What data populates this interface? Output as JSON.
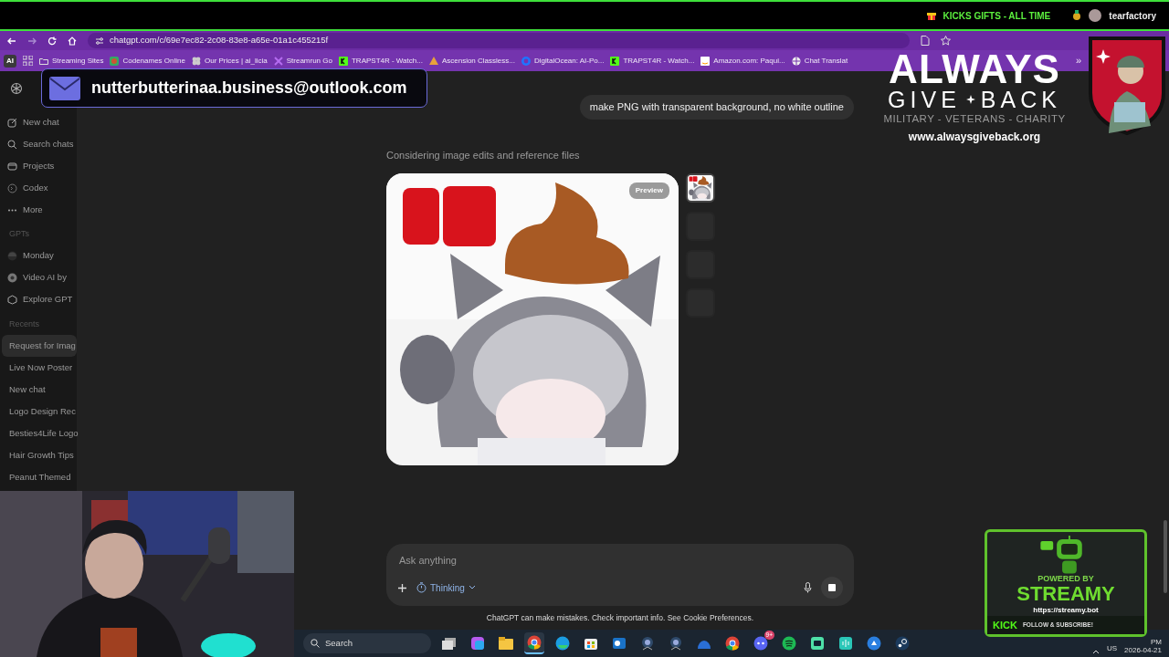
{
  "stream_bar": {
    "gifts_label": "KICKS GIFTS - ALL TIME",
    "username": "tearfactory"
  },
  "browser": {
    "url": "chatgpt.com/c/69e7ec82-2c08-83e8-a65e-01a1c455215f",
    "ai_badge": "AI",
    "overflow": "»",
    "bookmarks": [
      {
        "label": "Streaming Sites",
        "kind": "folder"
      },
      {
        "label": "Codenames Online",
        "kind": "game"
      },
      {
        "label": "Our Prices | ai_licia",
        "kind": "grid"
      },
      {
        "label": "Streamrun Go",
        "kind": "stream"
      },
      {
        "label": "TRAPST4R - Watch...",
        "kind": "kick"
      },
      {
        "label": "Ascension Classless...",
        "kind": "shield"
      },
      {
        "label": "DigitalOcean: AI-Po...",
        "kind": "ocean"
      },
      {
        "label": "TRAPST4R - Watch...",
        "kind": "kick"
      },
      {
        "label": "Amazon.com: Paqui...",
        "kind": "amazon"
      },
      {
        "label": "Chat Translat",
        "kind": "globe"
      }
    ]
  },
  "sidebar": {
    "nav": [
      {
        "label": "New chat",
        "kind": "compose"
      },
      {
        "label": "Search chats",
        "kind": "search"
      },
      {
        "label": "Projects",
        "kind": "projects"
      },
      {
        "label": "Codex",
        "kind": "codex"
      },
      {
        "label": "More",
        "kind": "more"
      }
    ],
    "gpts_heading": "GPTs",
    "gpts": [
      {
        "label": "Monday",
        "kind": "avatar"
      },
      {
        "label": "Video AI by",
        "kind": "badge"
      },
      {
        "label": "Explore GPT",
        "kind": "explore"
      }
    ],
    "recents_heading": "Recents",
    "recents": [
      {
        "label": "Request for Imag",
        "selected": true
      },
      {
        "label": "Live Now Poster",
        "selected": false
      },
      {
        "label": "New chat",
        "selected": false
      },
      {
        "label": "Logo Design Rec",
        "selected": false
      },
      {
        "label": "Besties4Life Logo",
        "selected": false
      },
      {
        "label": "Hair Growth Tips",
        "selected": false
      },
      {
        "label": "Peanut Themed",
        "selected": false
      }
    ]
  },
  "chat": {
    "user_message": "make PNG with transparent background, no white outline",
    "status": "Considering image edits and reference files",
    "image": {
      "kind": "picture",
      "badge": "Preview"
    },
    "thumbnails": [
      {
        "kind": "picture"
      },
      {
        "kind": "placeholder"
      },
      {
        "kind": "placeholder"
      },
      {
        "kind": "placeholder"
      }
    ]
  },
  "composer": {
    "placeholder": "Ask anything",
    "mode": "Thinking"
  },
  "disclaimer": {
    "text": "ChatGPT can make mistakes. Check important info. See",
    "link": "Cookie Preferences",
    "end": "."
  },
  "taskbar": {
    "search": "Search",
    "apps": [
      {
        "kind": "taskview",
        "selected": false
      },
      {
        "kind": "m365",
        "selected": false
      },
      {
        "kind": "files",
        "selected": false
      },
      {
        "kind": "chrome",
        "selected": true
      },
      {
        "kind": "edge",
        "selected": false
      },
      {
        "kind": "store",
        "selected": false
      },
      {
        "kind": "outlook",
        "selected": false
      },
      {
        "kind": "game",
        "selected": false
      },
      {
        "kind": "game",
        "selected": false
      },
      {
        "kind": "dome",
        "selected": false
      },
      {
        "kind": "chrome",
        "selected": false
      },
      {
        "kind": "discord",
        "selected": false,
        "badge": "9+"
      },
      {
        "kind": "spotify",
        "selected": false
      },
      {
        "kind": "chat",
        "selected": false
      },
      {
        "kind": "audio",
        "selected": false
      },
      {
        "kind": "bluebird",
        "selected": false
      },
      {
        "kind": "steam",
        "selected": false
      }
    ],
    "language": "US",
    "time": "PM",
    "date": "2026-04-21"
  },
  "overlays": {
    "email": "nutterbutterinaa.business@outlook.com",
    "charity": {
      "title": "ALWAYS",
      "word_left": "GIVE",
      "word_right": "BACK",
      "tagline": "MILITARY - VETERANS - CHARITY",
      "url": "www.alwaysgiveback.org"
    },
    "streamy": {
      "powered": "POWERED BY",
      "brand": "STREAMY",
      "url": "https://streamy.bot",
      "platform": "KICK",
      "cta": "FOLLOW & SUBSCRIBE!"
    }
  }
}
